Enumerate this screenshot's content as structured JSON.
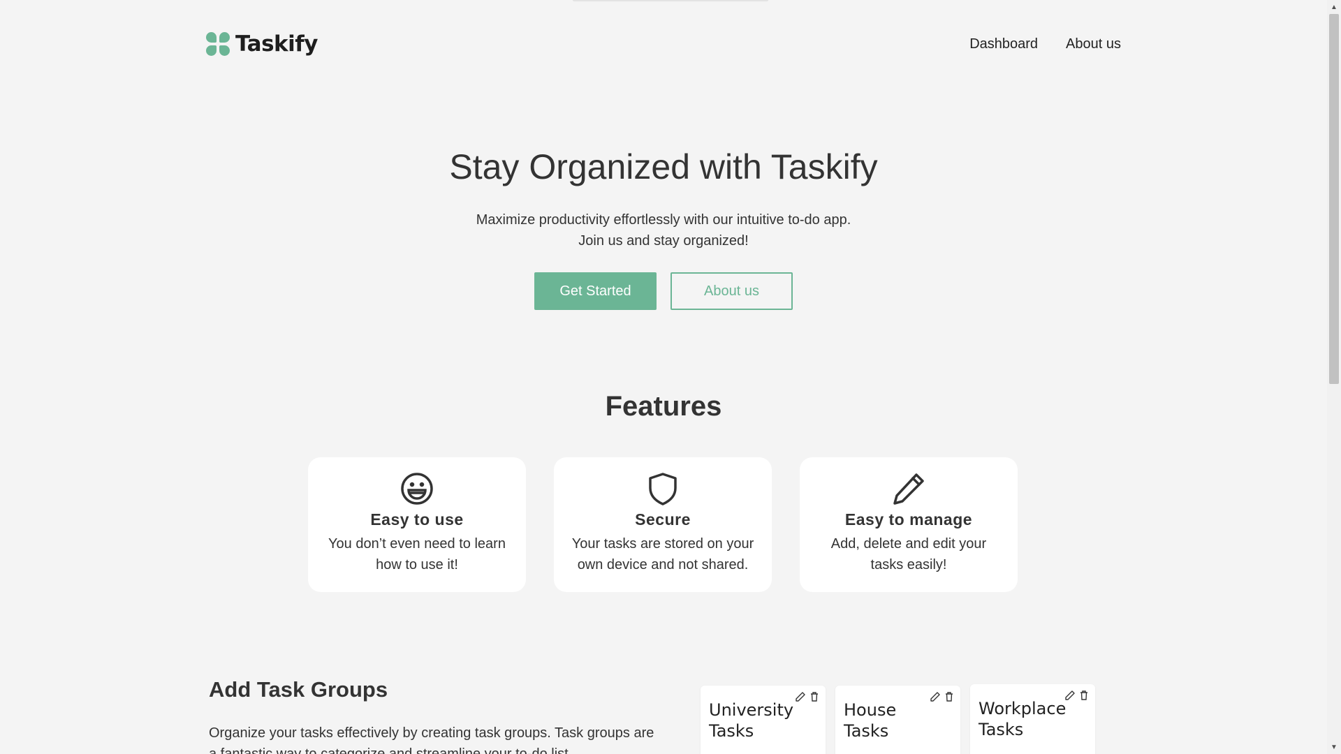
{
  "brand": {
    "name": "Taskify",
    "accent_color": "#6bb595"
  },
  "nav": {
    "items": [
      {
        "label": "Dashboard"
      },
      {
        "label": "About us"
      }
    ]
  },
  "hero": {
    "title": "Stay Organized with Taskify",
    "subtitle_line1": "Maximize productivity effortlessly with our intuitive to-do app.",
    "subtitle_line2": "Join us and stay organized!",
    "primary_button": "Get Started",
    "secondary_button": "About us"
  },
  "features": {
    "title": "Features",
    "items": [
      {
        "icon": "smile-icon",
        "title": "Easy to use",
        "desc_line1": "You don’t even need to learn",
        "desc_line2": "how to use it!"
      },
      {
        "icon": "shield-icon",
        "title": "Secure",
        "desc_line1": "Your tasks are stored on your",
        "desc_line2": "own device and not shared."
      },
      {
        "icon": "pencil-icon",
        "title": "Easy to manage",
        "desc_line1": "Add, delete and edit your",
        "desc_line2": "tasks easily!"
      }
    ]
  },
  "task_groups": {
    "title": "Add Task Groups",
    "description": "Organize your tasks effectively by creating task groups. Task groups are a fantastic way to categorize and streamline your to-do list.",
    "groups": [
      {
        "name": "University Tasks"
      },
      {
        "name": "House Tasks"
      },
      {
        "name": "Workplace Tasks"
      }
    ]
  }
}
